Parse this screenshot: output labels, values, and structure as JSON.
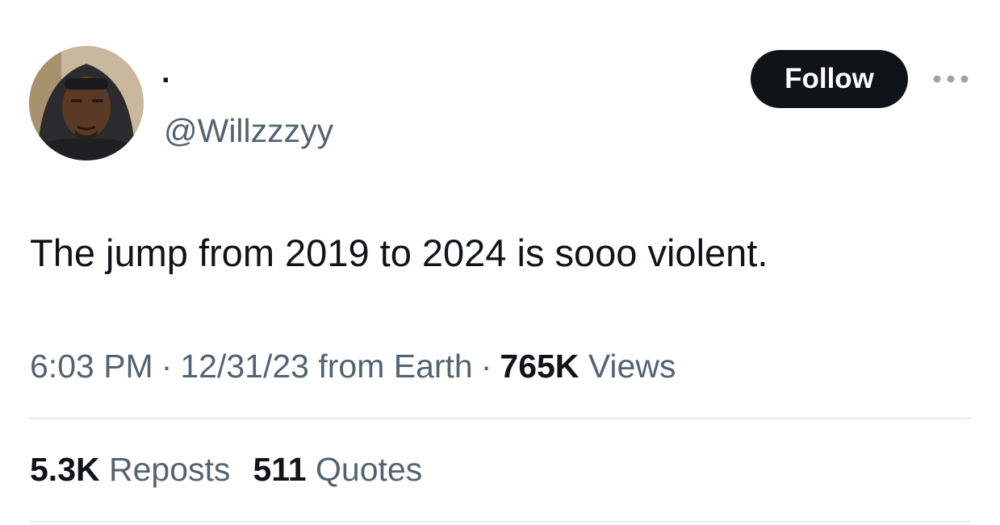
{
  "author": {
    "display_name": "·",
    "handle": "@Willzzzyy",
    "avatar_icon": "profile-photo"
  },
  "actions": {
    "follow_label": "Follow",
    "more_icon": "ellipsis-icon"
  },
  "tweet": {
    "text": "The jump from 2019 to 2024 is sooo violent."
  },
  "meta": {
    "time": "6:03 PM",
    "separator": "·",
    "date": "12/31/23 from Earth",
    "views_count": "765K",
    "views_label": "Views"
  },
  "stats": {
    "reposts_count": "5.3K",
    "reposts_label": "Reposts",
    "quotes_count": "511",
    "quotes_label": "Quotes"
  },
  "colors": {
    "text_primary": "#0f1419",
    "text_secondary": "#536471",
    "button_bg": "#0f1419",
    "divider": "#cfd9de"
  }
}
